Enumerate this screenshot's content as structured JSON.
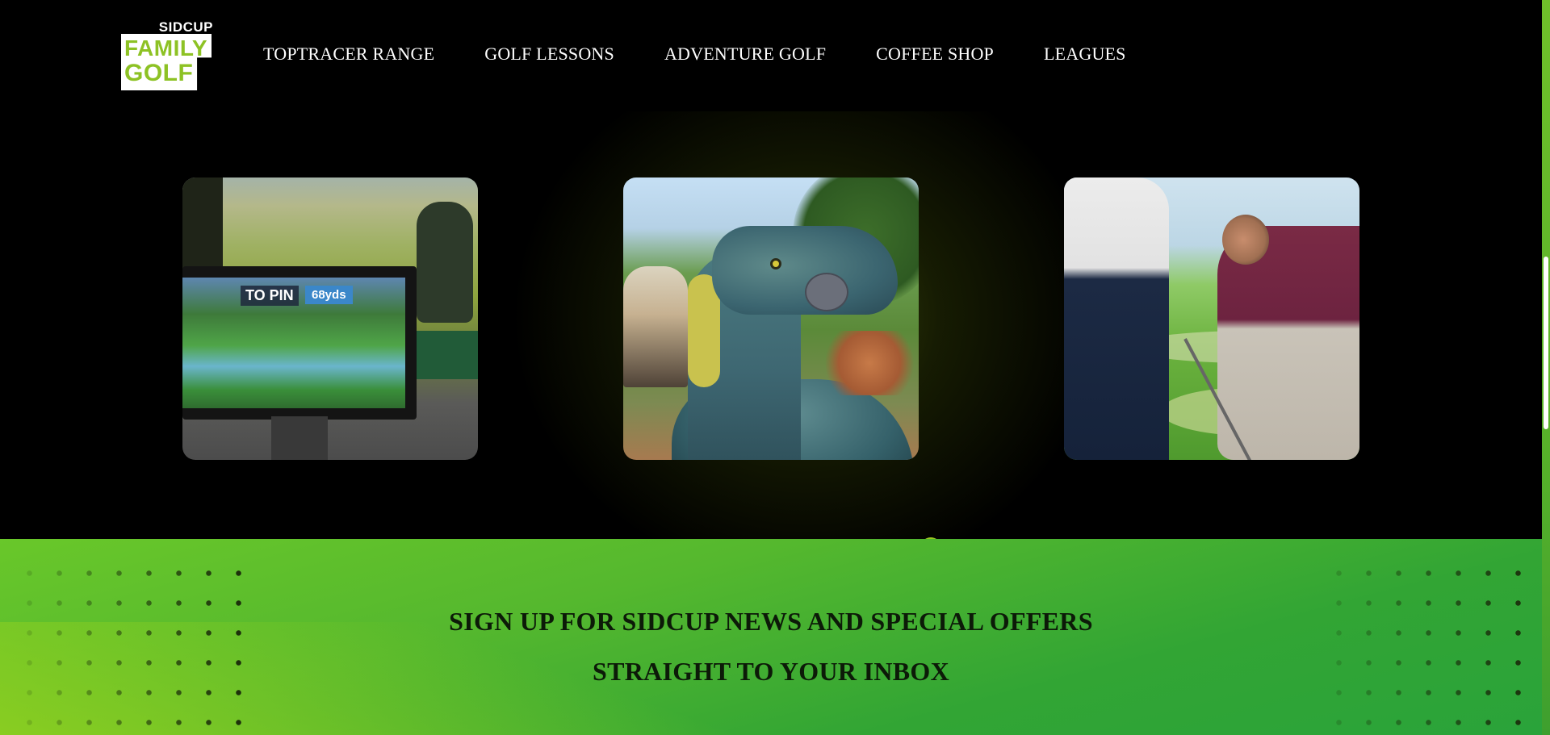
{
  "logo": {
    "top": "SIDCUP",
    "line1": "FAMILY",
    "line2": "GOLF"
  },
  "nav": {
    "items": [
      {
        "label": "TOPTRACER RANGE"
      },
      {
        "label": "GOLF LESSONS"
      },
      {
        "label": "ADVENTURE GOLF"
      },
      {
        "label": "COFFEE SHOP"
      },
      {
        "label": "LEAGUES"
      }
    ]
  },
  "carousel": {
    "card1": {
      "pin_label": "TO PIN",
      "yards": "68yds"
    }
  },
  "newsletter": {
    "line1": "SIGN UP FOR SIDCUP NEWS AND SPECIAL OFFERS",
    "line2": "STRAIGHT TO YOUR INBOX"
  },
  "colors": {
    "brand_green": "#8dc224",
    "band_green": "#3aa834",
    "background": "#000000"
  },
  "icons": [
    "carousel-dot-icon"
  ]
}
